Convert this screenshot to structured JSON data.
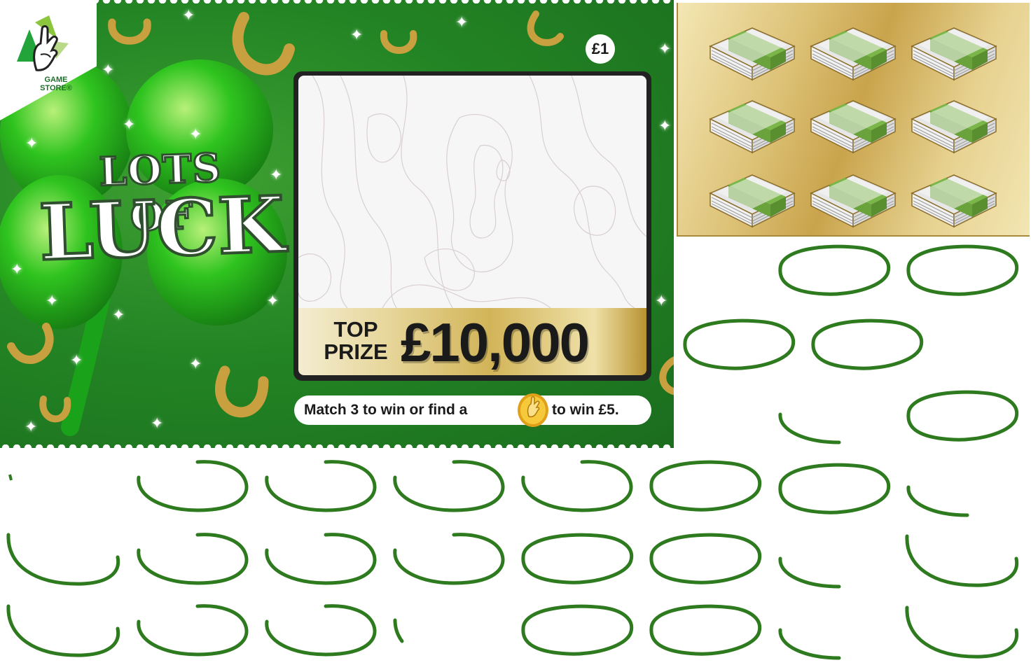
{
  "ticket": {
    "brand_line1": "GAME",
    "brand_line2": "STORE®",
    "title_line1": "LOTS OF",
    "title_line2": "LUCK",
    "price": "£1",
    "top_prize_label_1": "TOP",
    "top_prize_label_2": "PRIZE",
    "top_prize_amount": "£10,000",
    "rules_part1": "Match 3 to win or find a",
    "rules_part2": "to win £5."
  },
  "colors": {
    "ticket_green": "#238524",
    "ring_green": "#2e7a1e",
    "gold": "#d2b458",
    "band_green": "#7ab648"
  },
  "icons": [
    "national-lottery-logo-icon",
    "four-leaf-clover-icon",
    "horseshoe-icon",
    "sparkle-icon",
    "lucky-coin-icon",
    "cash-stack-icon"
  ],
  "symbol_panel": {
    "rows": 3,
    "columns": 3,
    "symbol": "cash-stack-icon"
  }
}
